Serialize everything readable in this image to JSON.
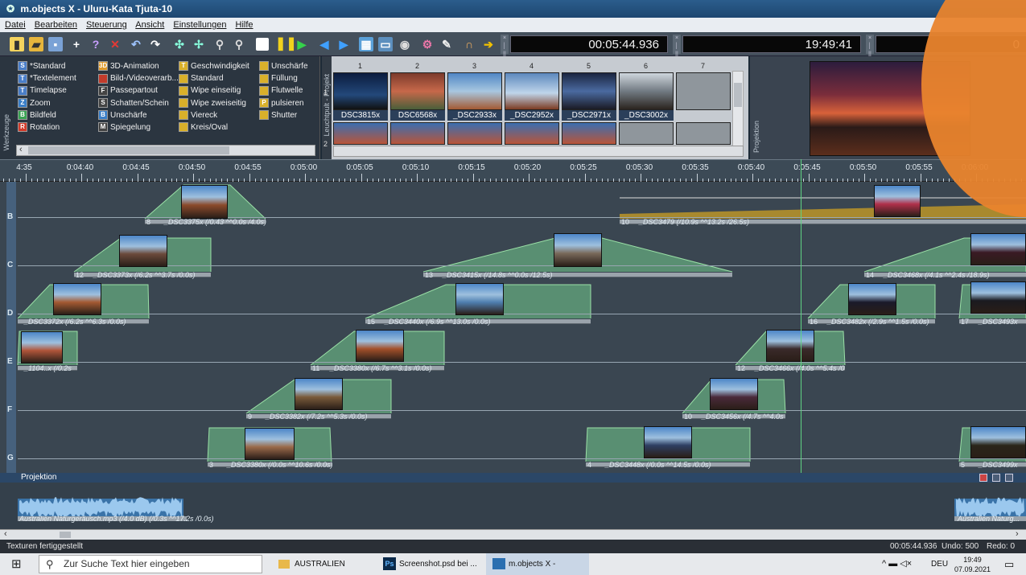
{
  "window": {
    "title": "m.objects X - Uluru-Kata Tjuta-10"
  },
  "menu": [
    "Datei",
    "Bearbeiten",
    "Steuerung",
    "Ansicht",
    "Einstellungen",
    "Hilfe"
  ],
  "toolbar": {
    "time1": "00:05:44.936",
    "time2": "19:49:41",
    "time3": "0"
  },
  "effects": {
    "col1": [
      "*Standard",
      "*Textelement",
      "Timelapse",
      "Zoom",
      "Bildfeld",
      "Rotation"
    ],
    "col2": [
      "3D-Animation",
      "Bild-/Videoverarb...",
      "Passepartout",
      "Schatten/Schein",
      "Unschärfe",
      "Spiegelung"
    ],
    "col3": [
      "Geschwindigkeit",
      "Standard",
      "Wipe einseitig",
      "Wipe zweiseitig",
      "Viereck",
      "Kreis/Oval"
    ],
    "col4": [
      "Unschärfe",
      "Füllung",
      "Flutwelle",
      "pulsieren",
      "Shutter"
    ],
    "side_label": "Werkzeuge",
    "icon_letters": {
      "col1": [
        "S",
        "T",
        "T",
        "Z",
        "B",
        "R"
      ],
      "col2": [
        "3D",
        "",
        "F",
        "S",
        "B",
        "M"
      ],
      "col3": [
        "T",
        "",
        "",
        "",
        "",
        ""
      ],
      "col4": [
        "",
        "",
        "",
        "P",
        ""
      ]
    }
  },
  "lighttable": {
    "side_label": "Leuchtpult - Projekt",
    "row_nums": [
      "1",
      "2"
    ],
    "columns": [
      "1",
      "2",
      "3",
      "4",
      "5",
      "6",
      "7"
    ],
    "captions": [
      "DSC3815x",
      "DSC6568x",
      "_DSC2933x",
      "_DSC2952x",
      "_DSC2971x",
      "_DSC3002x"
    ]
  },
  "projection_panel": {
    "side_label": "Projektion"
  },
  "ruler": {
    "labels": [
      "4:35",
      "0:04:40",
      "0:04:45",
      "0:04:50",
      "0:04:55",
      "0:05:00",
      "0:05:05",
      "0:05:10",
      "0:05:15",
      "0:05:20",
      "0:05:25",
      "0:05:30",
      "0:05:35",
      "0:05:40",
      "0:05:45",
      "0:05:50",
      "0:05:55",
      "0:06:00"
    ]
  },
  "lanes": [
    "B",
    "C",
    "D",
    "E",
    "F",
    "G"
  ],
  "clips": [
    {
      "num": "8",
      "caption": "_DSC3375x (/0.43 ^^0.0s /4.0s)"
    },
    {
      "num": "12",
      "caption": "_DSC3373x (/6.2s ^^3.7s /0.0s)"
    },
    {
      "num": "",
      "caption": "_DSC3372x (/6.2s ^^6.3s /0.0s)"
    },
    {
      "num": "",
      "caption": "_1104..x (/0.2s"
    },
    {
      "num": "9",
      "caption": "_DSC3382x (/7.2s ^^5.3s /0.0s)"
    },
    {
      "num": "3",
      "caption": "_DSC3380x (/0.0s ^^10.6s /0.0s)"
    },
    {
      "num": "13",
      "caption": "_DSC3415x (/14.8s ^^0.0s /12.5s)"
    },
    {
      "num": "15",
      "caption": "_DSC3440x (/6.9s ^^13.0s /0.0s)"
    },
    {
      "num": "11",
      "caption": "_DSC3380x (/6.7s ^^3.1s /0.0s)"
    },
    {
      "num": "4",
      "caption": "_DSC3448x (/0.0s ^^14.5s /0.0s)"
    },
    {
      "num": "10",
      "caption": "_DSC3479 (/10.9s ^^13.2s /26.5s)"
    },
    {
      "num": "16",
      "caption": "_DSC3482x (/2.9s ^^1.5s /0.0s)"
    },
    {
      "num": "12",
      "caption": "_DSC3466x (/4.0s ^^5.4s /0"
    },
    {
      "num": "10",
      "caption": "_DSC3456x (/4.7s ^^4.0s"
    },
    {
      "num": "14",
      "caption": "_DSC3468x (/4.1s ^^2.4s /18.9s)"
    },
    {
      "num": "17",
      "caption": "_DSC3493x"
    },
    {
      "num": "5",
      "caption": "_DSC3499x"
    }
  ],
  "projection_bar": {
    "label": "Projektion"
  },
  "audio": {
    "caption1": "Australien Naturgeräusch.mp3 (/4.0 dB) (/0.3s ^^17.2s /0.0s)",
    "caption2": "Australien Naturg..."
  },
  "status": {
    "left": "Texturen fertiggestellt",
    "time": "00:05:44.936",
    "undo": "Undo: 500",
    "redo": "Redo: 0"
  },
  "taskbar": {
    "search": "Zur Suche Text hier eingeben",
    "items": [
      "AUSTRALIEN",
      "Screenshot.psd bei ...",
      "m.objects X - [Uluru..."
    ],
    "tray_lang": "DEU",
    "clock_time": "19:49",
    "clock_date": "07.09.2021"
  }
}
